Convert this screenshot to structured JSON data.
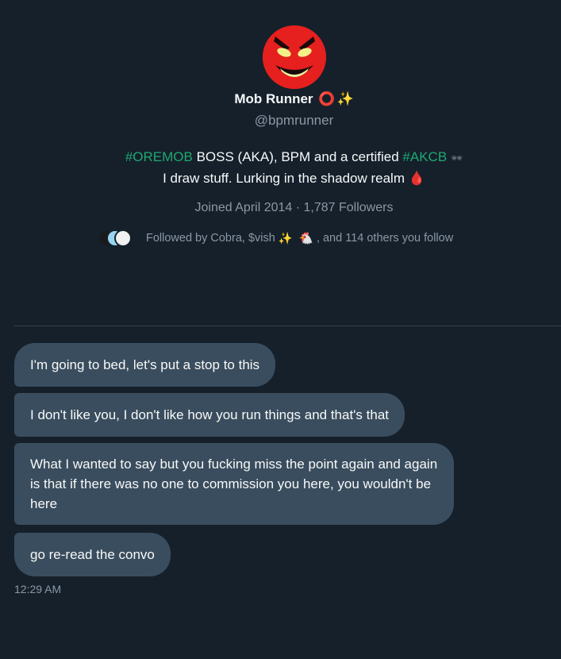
{
  "profile": {
    "name": "Mob Runner",
    "name_emoji_ring": "⭕",
    "name_emoji_sparkle": "✨",
    "handle": "@bpmrunner",
    "bio_tag1": "#OREMOB",
    "bio_text1": " BOSS (AKA), BPM and a certified ",
    "bio_tag2": "#AKCB",
    "bio_glasses": "🕶",
    "bio_line2": "I draw stuff. Lurking in the shadow realm ",
    "bio_drop": "🩸",
    "joined": "Joined April 2014",
    "separator": " · ",
    "followers": "1,787 Followers",
    "followed_prefix": "Followed by Cobra, $vish",
    "followed_emoji1": "✨",
    "followed_emoji2": "🐔",
    "followed_suffix": ", and 114 others you follow"
  },
  "messages": [
    {
      "text": "I'm going to bed, let's put a stop to this"
    },
    {
      "text": "I don't like you, I don't like how you run things and that's that"
    },
    {
      "text": "What I wanted to say but you fucking miss the point again and again is that if there was no one to commission you here, you wouldn't be here"
    },
    {
      "text": "go re-read the convo"
    }
  ],
  "timestamp": "12:29 AM",
  "colors": {
    "background": "#15202b",
    "bubble": "#3a4d5e",
    "hashtag": "#1fa971",
    "muted": "#8b98a5",
    "avatar_red": "#e5201e"
  },
  "icons": {
    "avatar": "red-devil-face-avatar",
    "followers_stack": "follower-avatars-stack"
  }
}
